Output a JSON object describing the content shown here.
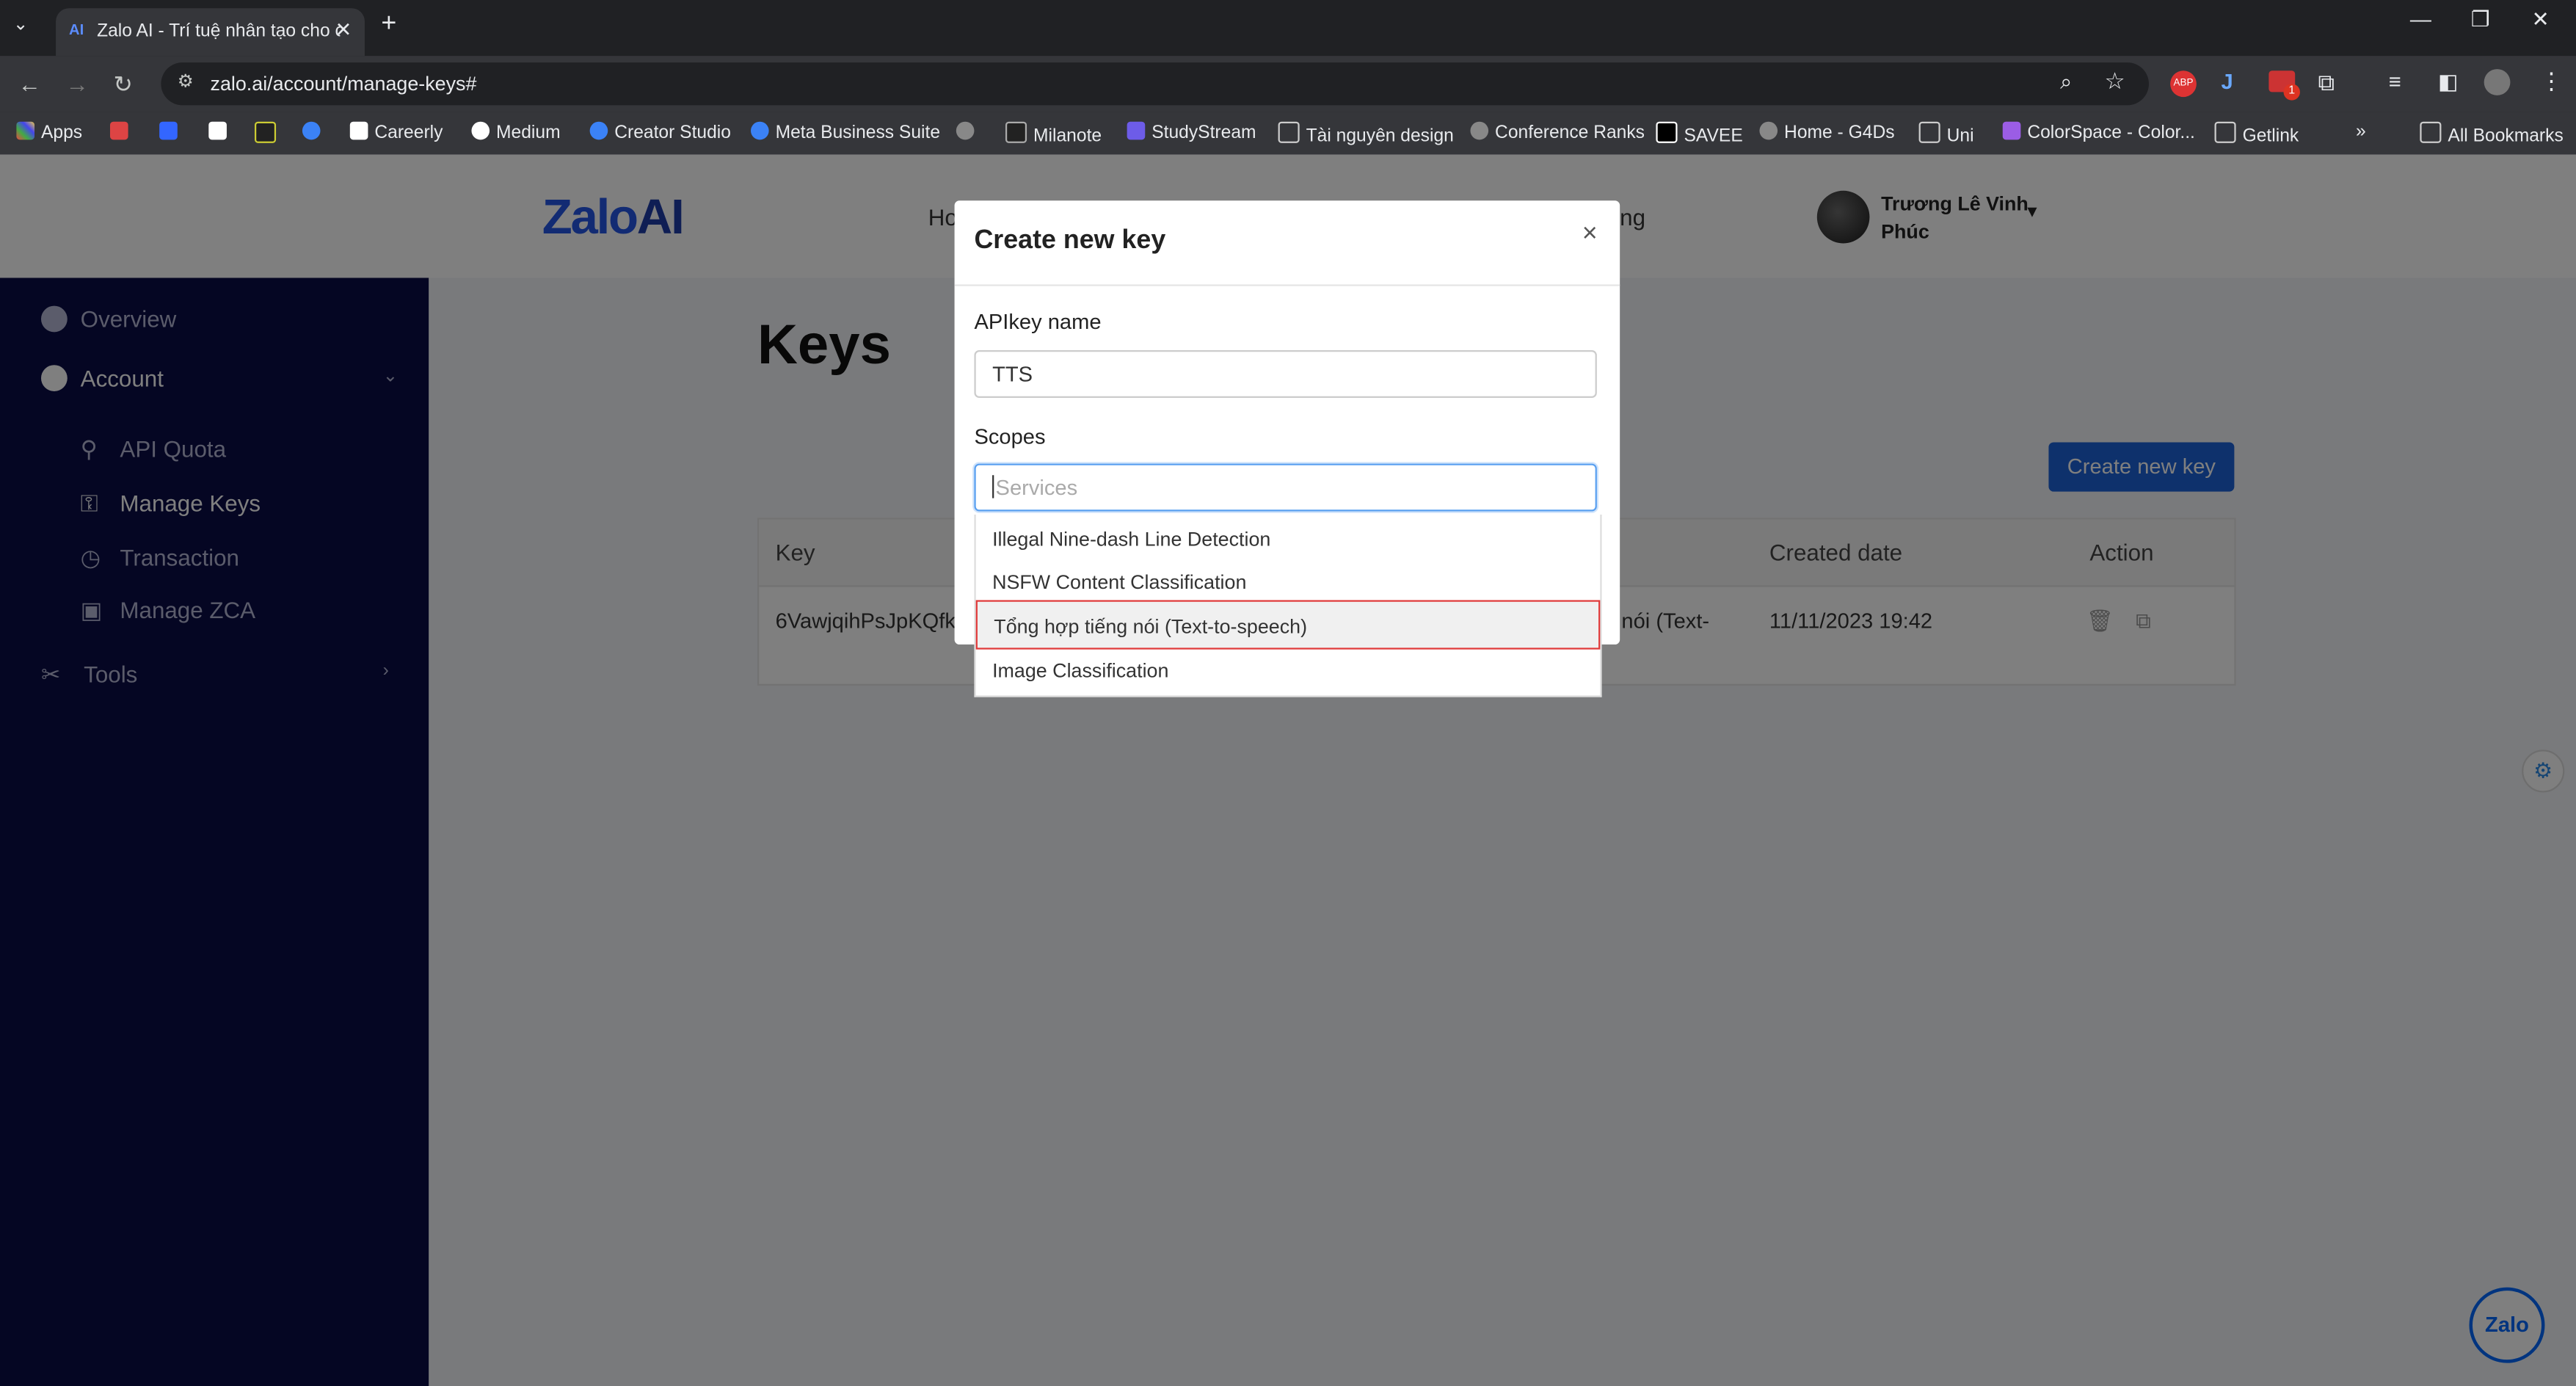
{
  "browser": {
    "tab_title": "Zalo AI - Trí tuệ nhân tạo cho c",
    "tab_favicon": "AI",
    "url": "zalo.ai/account/manage-keys#",
    "bookmarks": [
      "Apps",
      "Careerly",
      "Medium",
      "Creator Studio",
      "Meta Business Suite",
      "Milanote",
      "StudyStream",
      "Tài nguyên design",
      "Conference Ranks",
      "SAVEE",
      "Home - G4Ds",
      "Uni",
      "ColorSpace - Color...",
      "Getlink"
    ],
    "all_bookmarks": "All Bookmarks",
    "abp_badge": "ABP",
    "mail_badge": "1"
  },
  "header": {
    "logo_zalo": "Zalo",
    "logo_ai": "AI",
    "nav_left": "Ho",
    "nav_right": "ng",
    "user_name_line1": "Trương Lê Vinh",
    "user_name_line2": "Phúc"
  },
  "sidebar": {
    "overview": "Overview",
    "account": "Account",
    "api_quota": "API Quota",
    "manage_keys": "Manage Keys",
    "transaction": "Transaction",
    "manage_zca": "Manage ZCA",
    "tools": "Tools"
  },
  "content": {
    "title": "Keys",
    "create_button": "Create new key",
    "columns": [
      "Key",
      "Created date",
      "Action"
    ],
    "row": {
      "key": "6VawjqihPsJpKQfk",
      "scope_fragment": "nói (Text-",
      "created_date": "11/11/2023 19:42"
    }
  },
  "modal": {
    "title": "Create new key",
    "close": "×",
    "apikey_label": "APIkey name",
    "apikey_value": "TTS",
    "scopes_label": "Scopes",
    "scopes_placeholder": "Services",
    "options": [
      "Illegal Nine-dash Line Detection",
      "NSFW Content Classification",
      "Tổng hợp tiếng nói (Text-to-speech)",
      "Image Classification"
    ],
    "highlighted_index": 2
  },
  "widgets": {
    "zalo_chat": "Zalo"
  },
  "colors": {
    "sidebar_bg": "#0b0d47",
    "primary_blue": "#1d63d8",
    "highlight_border": "#e03a3a"
  }
}
